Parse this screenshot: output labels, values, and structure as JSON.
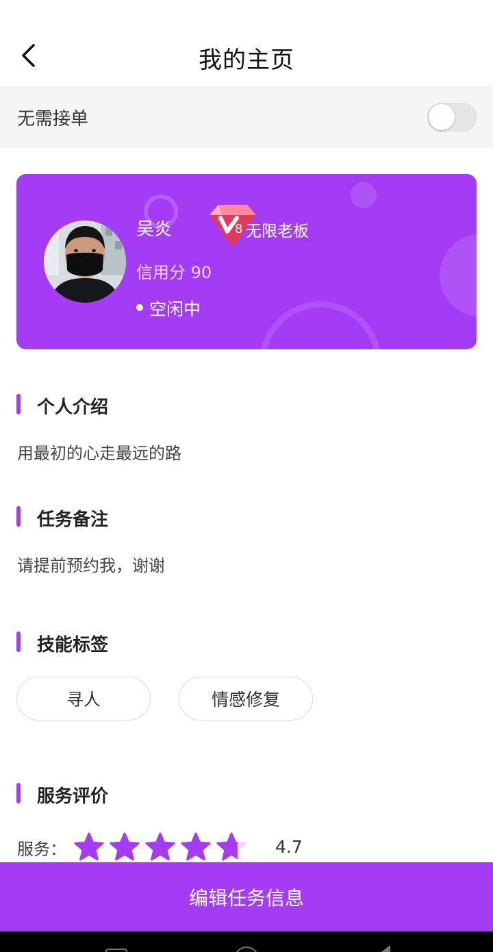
{
  "header": {
    "title": "我的主页",
    "back_icon": "chevron-left-icon"
  },
  "toggle": {
    "label": "无需接单",
    "enabled": false
  },
  "profile": {
    "name": "吴炎",
    "vip_level": "8",
    "vip_title": "无限老板",
    "credit": "信用分 90",
    "status": "空闲中",
    "avatar_icon": "user-avatar"
  },
  "sections": {
    "intro": {
      "title": "个人介绍",
      "body": "用最初的心走最远的路"
    },
    "notes": {
      "title": "任务备注",
      "body": "请提前预约我，谢谢"
    },
    "skills": {
      "title": "技能标签",
      "tags": [
        "寻人",
        "情感修复"
      ]
    },
    "reviews": {
      "title": "服务评价",
      "label": "服务：",
      "score": "4.7",
      "rating": 4.7,
      "max": 5
    }
  },
  "actions": {
    "edit_label": "编辑任务信息"
  },
  "colors": {
    "accent": "#a43cf5",
    "toggle_bg": "#f5f5f5",
    "star_empty": "#ead8fd"
  }
}
